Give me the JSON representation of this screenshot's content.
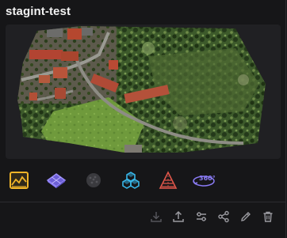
{
  "project": {
    "title": "stagint-test"
  },
  "colors": {
    "background": "#161618",
    "map_background": "#202023",
    "accent_yellow": "#f0b429",
    "accent_purple": "#8b7cf6",
    "accent_cyan": "#38b6e8",
    "accent_red": "#e0564a",
    "icon_gray": "#8a8a90"
  },
  "tools": [
    {
      "icon": "orthophoto-icon",
      "state": "active"
    },
    {
      "icon": "3d-model-icon",
      "state": "enabled"
    },
    {
      "icon": "pointcloud-icon",
      "state": "disabled"
    },
    {
      "icon": "cubes-icon",
      "state": "enabled"
    },
    {
      "icon": "contour-icon",
      "state": "enabled"
    },
    {
      "icon": "360-view-icon",
      "state": "enabled"
    }
  ],
  "badge_360": "360°",
  "actions": [
    {
      "icon": "download-icon",
      "state": "disabled"
    },
    {
      "icon": "upload-icon",
      "state": "enabled"
    },
    {
      "icon": "settings-sliders-icon",
      "state": "enabled"
    },
    {
      "icon": "share-icon",
      "state": "enabled"
    },
    {
      "icon": "edit-icon",
      "state": "enabled"
    },
    {
      "icon": "delete-icon",
      "state": "enabled"
    }
  ]
}
